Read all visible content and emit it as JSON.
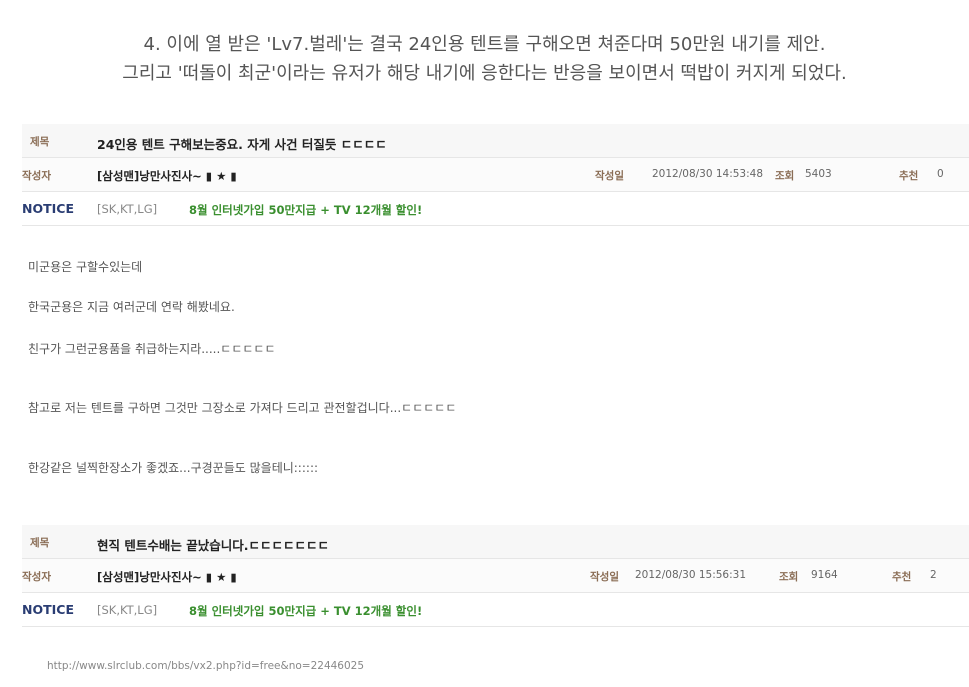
{
  "caption": {
    "line1": "4. 이에 열 받은 'Lv7.벌레'는 결국 24인용 텐트를 구해오면 쳐준다며 50만원 내기를 제안.",
    "line2": "그리고 '떠돌이 최군'이라는 유저가 해당 내기에 응한다는 반응을 보이면서 떡밥이 커지게 되었다."
  },
  "posts": [
    {
      "title_label": "제목",
      "title": "24인용 텐트 구해보는중요. 자게 사건 터질듯 ㄷㄷㄷㄷ",
      "author_label": "작성자",
      "author": "[삼성맨]낭만사진사~ ▮ ★ ▮",
      "date_label": "작성일",
      "date": "2012/08/30 14:53:48",
      "views_label": "조회",
      "views": "5403",
      "rec_label": "추천",
      "rec": "0",
      "notice_label": "NOTICE",
      "notice_carrier": "[SK,KT,LG]",
      "notice_text": "8월 인터넷가입 50만지급 + TV 12개월 할인!",
      "body": [
        "미군용은 구할수있는데",
        "한국군용은 지금 여러군데 연락 해봤네요.",
        "친구가 그런군용품을 취급하는지라.....ㄷㄷㄷㄷㄷ",
        "참고로 저는 텐트를 구하면 그것만 그장소로 가져다 드리고 관전할겁니다...ㄷㄷㄷㄷㄷ",
        "한강같은 널찍한장소가 좋겠죠...구경꾼들도 많을테니::::::"
      ]
    },
    {
      "title_label": "제목",
      "title": "현직 텐트수배는 끝났습니다.ㄷㄷㄷㄷㄷㄷㄷ",
      "author_label": "작성자",
      "author": "[삼성맨]낭만사진사~ ▮ ★ ▮",
      "date_label": "작성일",
      "date": "2012/08/30 15:56:31",
      "views_label": "조회",
      "views": "9164",
      "rec_label": "추천",
      "rec": "2",
      "notice_label": "NOTICE",
      "notice_carrier": "[SK,KT,LG]",
      "notice_text": "8월 인터넷가입 50만지급 + TV 12개월 할인!"
    }
  ],
  "source_url": "http://www.slrclub.com/bbs/vx2.php?id=free&no=22446025"
}
